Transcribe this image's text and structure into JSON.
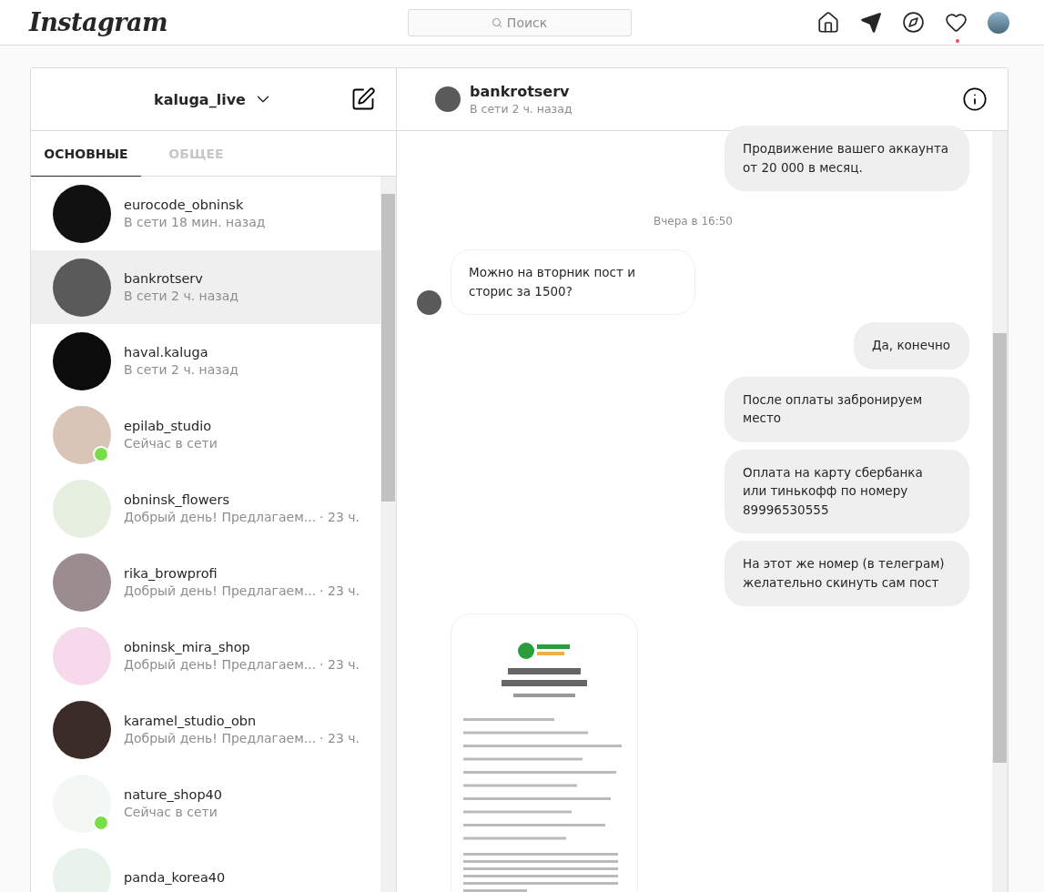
{
  "topbar": {
    "logo": "Instagram",
    "search_placeholder": "Поиск",
    "has_notification": true
  },
  "inbox": {
    "account": "kaluga_live",
    "tabs": [
      {
        "label": "ОСНОВНЫЕ",
        "selected": true
      },
      {
        "label": "ОБЩЕЕ",
        "selected": false
      }
    ],
    "threads": [
      {
        "name": "eurocode_obninsk",
        "status": "В сети 18 мин. назад",
        "online": false,
        "selected": false
      },
      {
        "name": "bankrotserv",
        "status": "В сети 2 ч. назад",
        "online": false,
        "selected": true
      },
      {
        "name": "haval.kaluga",
        "status": "В сети 2 ч. назад",
        "online": false,
        "selected": false
      },
      {
        "name": "epilab_studio",
        "status": "Сейчас в сети",
        "online": true,
        "selected": false
      },
      {
        "name": "obninsk_flowers",
        "status": "Добрый день! Предлагаем...",
        "time": "· 23 ч.",
        "online": false,
        "selected": false
      },
      {
        "name": "rika_browprofi",
        "status": "Добрый день! Предлагаем...",
        "time": "· 23 ч.",
        "online": false,
        "selected": false
      },
      {
        "name": "obninsk_mira_shop",
        "status": "Добрый день! Предлагаем...",
        "time": "· 23 ч.",
        "online": false,
        "selected": false
      },
      {
        "name": "karamel_studio_obn",
        "status": "Добрый день! Предлагаем...",
        "time": "· 23 ч.",
        "online": false,
        "selected": false
      },
      {
        "name": "nature_shop40",
        "status": "Сейчас в сети",
        "online": true,
        "selected": false
      },
      {
        "name": "panda_korea40",
        "online": false,
        "selected": false
      }
    ]
  },
  "chat": {
    "name": "bankrotserv",
    "status": "В сети 2 ч. назад",
    "messages": [
      {
        "kind": "text",
        "outgoing": true,
        "text": "Продвижение вашего аккаунта от 20 000 в месяц."
      },
      {
        "kind": "time",
        "text": "Вчера в 16:50"
      },
      {
        "kind": "text",
        "outgoing": false,
        "text": "Можно на вторник пост и сторис за 1500?"
      },
      {
        "kind": "text",
        "outgoing": true,
        "text": "Да, конечно"
      },
      {
        "kind": "text",
        "outgoing": true,
        "text": "После оплаты забронируем место"
      },
      {
        "kind": "text",
        "outgoing": true,
        "text": "Оплата на карту сбербанка или тинькофф по номеру 89996530555"
      },
      {
        "kind": "text",
        "outgoing": true,
        "text": "На этот же номер (в телеграм) желательно скинуть сам пост"
      },
      {
        "kind": "image",
        "outgoing": false
      }
    ]
  }
}
